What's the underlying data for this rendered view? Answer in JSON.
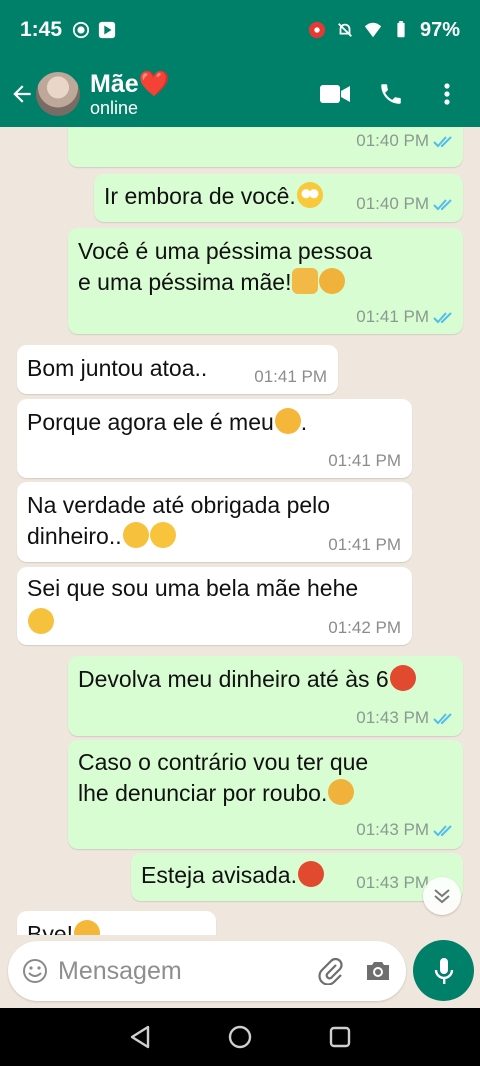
{
  "status_bar": {
    "time": "1:45",
    "battery": "97%"
  },
  "header": {
    "name": "Mãe❤️",
    "status": "online"
  },
  "messages": [
    {
      "dir": "out",
      "text": "",
      "time": "01:40 PM"
    },
    {
      "dir": "out",
      "text": "Ir embora de você.",
      "time": "01:40 PM",
      "emoji": "face-with-rolling-eyes"
    },
    {
      "dir": "out",
      "line1": "Você é uma péssima pessoa",
      "line2": "e uma péssima mãe!",
      "time": "01:41 PM",
      "emoji": "thumbs-up, angry-face"
    },
    {
      "dir": "in",
      "text": "Bom juntou atoa..",
      "time": "01:41 PM"
    },
    {
      "dir": "in",
      "text": "Porque agora ele é meu",
      "suffix": ".",
      "time": "01:41 PM",
      "emoji": "smiling-cat-heart-eyes"
    },
    {
      "dir": "in",
      "line1": "Na verdade até obrigada pelo",
      "line2": "dinheiro..",
      "time": "01:41 PM",
      "emoji": "hand-over-mouth, face-blowing-kiss"
    },
    {
      "dir": "in",
      "text": "Sei que sou uma bela mãe hehe",
      "time": "01:42 PM",
      "emoji": "hand-over-mouth"
    },
    {
      "dir": "out",
      "text": "Devolva meu dinheiro até às 6",
      "time": "01:43 PM",
      "emoji": "pouting-face"
    },
    {
      "dir": "out",
      "line1": "Caso o contrário vou ter que",
      "line2": "lhe denunciar por roubo.",
      "time": "01:43 PM",
      "emoji": "unamused-face"
    },
    {
      "dir": "out",
      "text": "Esteja avisada.",
      "time": "01:43 PM",
      "emoji": "pouting-face"
    },
    {
      "dir": "in",
      "text": "Bye!",
      "time": "",
      "emoji": "cat-face"
    }
  ],
  "composer": {
    "placeholder": "Mensagem"
  },
  "colors": {
    "header": "#008069",
    "outgoing": "#d9fdd3",
    "incoming": "#ffffff",
    "read_ticks": "#53bdeb"
  }
}
